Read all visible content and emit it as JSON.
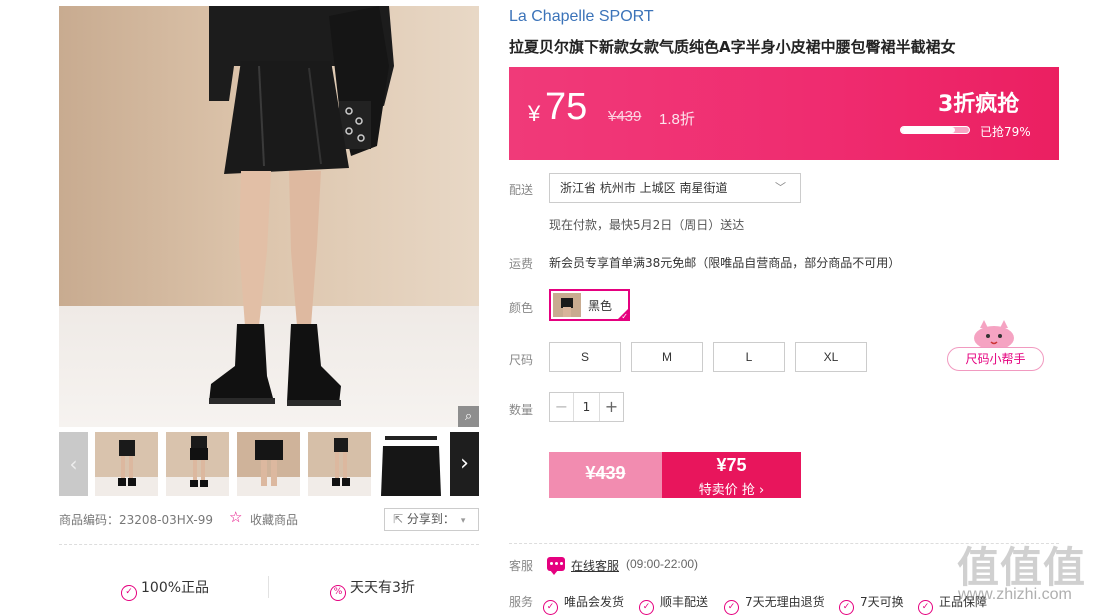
{
  "product": {
    "brand": "La Chapelle SPORT",
    "title": "拉夏贝尔旗下新款女款气质纯色A字半身小皮裙中腰包臀裙半截裙女",
    "code": "商品编码：23208-03HX-99",
    "favorite_label": "收藏商品",
    "share_label": "分享到："
  },
  "price": {
    "currency": "¥",
    "current": "75",
    "original": "¥439",
    "discount": "1.8折",
    "flash_label": "3折疯抢",
    "sold_text": "已抢79%",
    "sold_fraction": 0.79
  },
  "delivery": {
    "label": "配送",
    "address": "浙江省 杭州市 上城区 南星街道",
    "note": "现在付款，最快5月2日（周日）送达"
  },
  "shipping": {
    "label": "运费",
    "text": "新会员专享首单满38元免邮（限唯品自营商品，部分商品不可用）"
  },
  "color": {
    "label": "颜色",
    "selected": "黑色"
  },
  "size": {
    "label": "尺码",
    "options": [
      "S",
      "M",
      "L",
      "XL"
    ],
    "helper": "尺码小帮手"
  },
  "quantity": {
    "label": "数量",
    "minus": "−",
    "value": "1",
    "plus": "+"
  },
  "buy": {
    "original": "¥439",
    "price": "¥75",
    "label": "特卖价 抢 ›"
  },
  "customer_service": {
    "label": "客服",
    "link": "在线客服",
    "hours": "(09:00-22:00)"
  },
  "services": {
    "label": "服务",
    "items": [
      "唯品会发货",
      "顺丰配送",
      "7天无理由退货",
      "7天可换",
      "正品保障"
    ]
  },
  "promises": {
    "genuine": "100%正品",
    "daily": "天天有3折"
  },
  "gallery": {
    "zoom_icon": "magnifier-icon",
    "prev_icon": "chevron-left-icon",
    "next_icon": "chevron-right-icon"
  },
  "watermark": {
    "text": "值值值",
    "url": "www.zhizhi.com"
  },
  "colors": {
    "accent": "#e5007f",
    "price_bar": "#ef2b6f",
    "brand_link": "#3b73b9"
  }
}
